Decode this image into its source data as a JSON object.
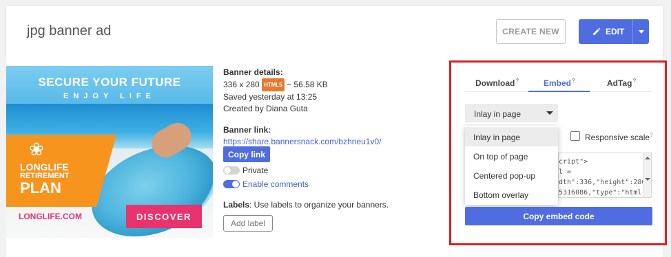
{
  "header": {
    "title": "jpg banner ad",
    "create_new_label": "CREATE NEW",
    "edit_label": "EDIT"
  },
  "banner": {
    "headline": "SECURE YOUR FUTURE",
    "subheadline": "ENJOY LIFE",
    "plan_line1": "LONGLIFE",
    "plan_line2": "RETIREMENT",
    "plan_line3": "PLAN",
    "website": "LONGLIFE.COM",
    "cta": "DISCOVER"
  },
  "details": {
    "heading": "Banner details:",
    "dimensions": "336 x 280",
    "format_badge": "HTML5",
    "size": "~ 56.58 KB",
    "saved": "Saved yesterday at 13:25",
    "created_by": "Created by Diana Guta",
    "link_heading": "Banner link:",
    "link_url": "https://share.bannersnack.com/bzhneu1v0/",
    "copy_link_label": "Copy link",
    "private_label": "Private",
    "comments_label": "Enable comments",
    "labels_heading": "Labels",
    "labels_hint": ": Use labels to organize your banners.",
    "add_label": "Add label"
  },
  "embed_panel": {
    "tabs": [
      {
        "label": "Download",
        "help": "?"
      },
      {
        "label": "Embed",
        "help": "?"
      },
      {
        "label": "AdTag",
        "help": "?"
      }
    ],
    "select_value": "Inlay in page",
    "options": [
      "Inlay in page",
      "On top of page",
      "Centered pop-up",
      "Bottom overlay"
    ],
    "responsive_label": "Responsive scale",
    "responsive_help": "?",
    "code_lines": [
      "cript\">",
      "l =",
      "dth\":336,\"height\":280,\"t",
      "5316086,\"type\":\"html"
    ],
    "copy_embed_label": "Copy embed code"
  }
}
